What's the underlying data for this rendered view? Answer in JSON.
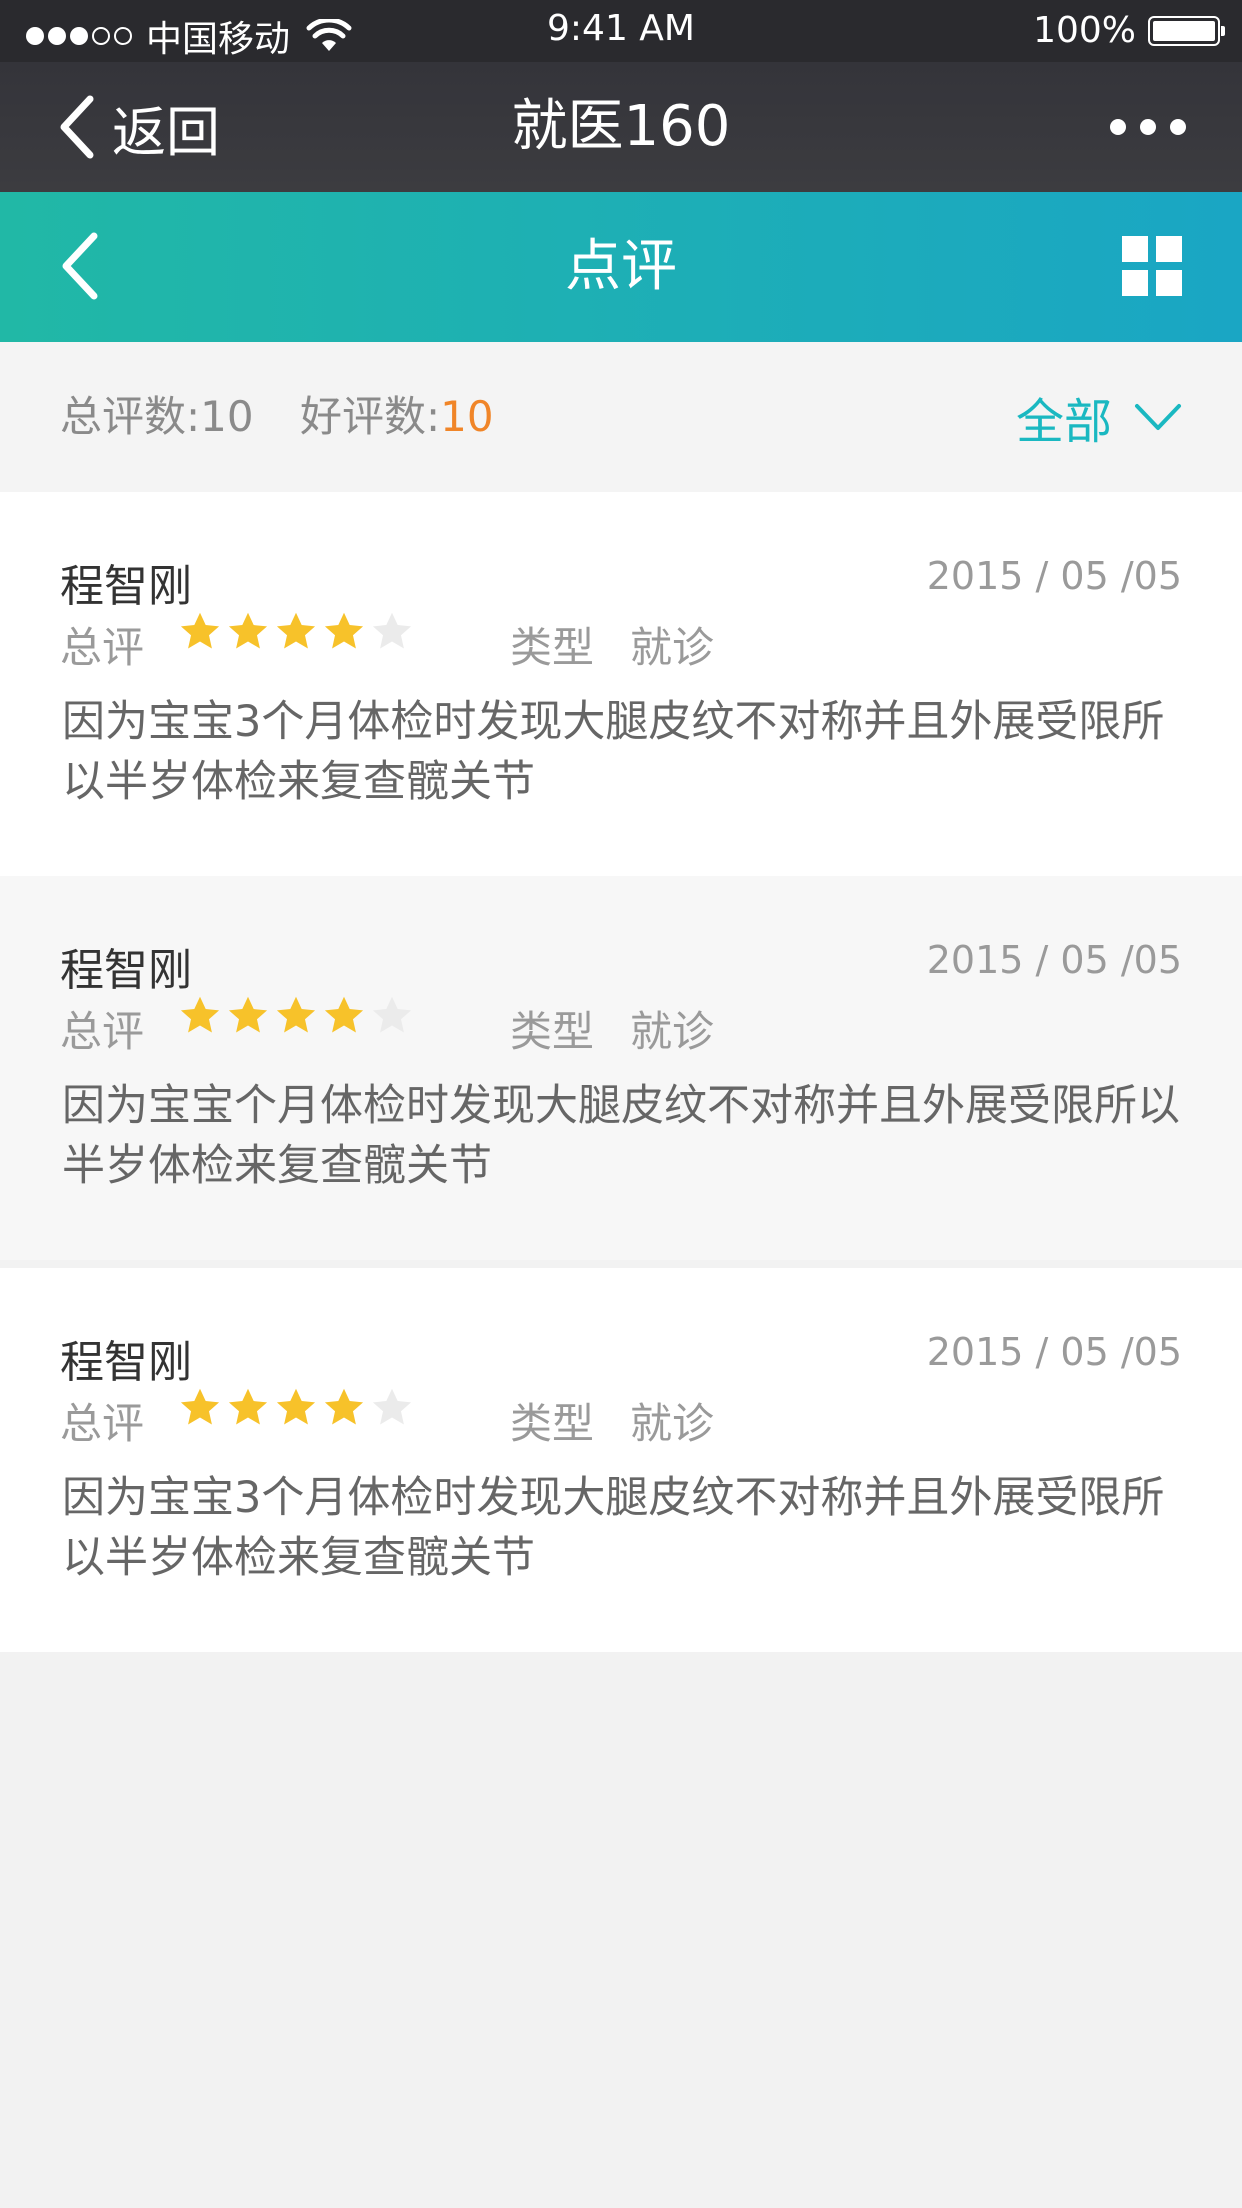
{
  "status_bar": {
    "carrier": "中国移动",
    "time": "9:41 AM",
    "battery": "100%"
  },
  "nav": {
    "back_label": "返回",
    "title": "就医160"
  },
  "header": {
    "title": "点评"
  },
  "summary": {
    "total_label": "总评数:",
    "total_count": "10",
    "good_label": "好评数:",
    "good_count": "10",
    "filter_label": "全部"
  },
  "colors": {
    "accent_teal": "#1ab8c1",
    "star_gold": "#f7c22a",
    "count_orange": "#f08528"
  },
  "reviews": [
    {
      "name": "程智刚",
      "date": "2015 / 05 /05",
      "rating_label": "总评",
      "rating": 4,
      "max_rating": 5,
      "type_label": "类型",
      "type_value": "就诊",
      "text": "因为宝宝3个月体检时发现大腿皮纹不对称并且外展受限所以半岁体检来复查髋关节"
    },
    {
      "name": "程智刚",
      "date": "2015 / 05 /05",
      "rating_label": "总评",
      "rating": 4,
      "max_rating": 5,
      "type_label": "类型",
      "type_value": "就诊",
      "text": "因为宝宝个月体检时发现大腿皮纹不对称并且外展受限所以半岁体检来复查髋关节"
    },
    {
      "name": "程智刚",
      "date": "2015 / 05 /05",
      "rating_label": "总评",
      "rating": 4,
      "max_rating": 5,
      "type_label": "类型",
      "type_value": "就诊",
      "text": "因为宝宝3个月体检时发现大腿皮纹不对称并且外展受限所以半岁体检来复查髋关节"
    }
  ]
}
